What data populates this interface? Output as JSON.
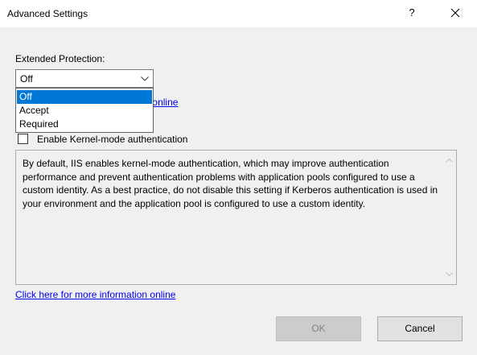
{
  "dialog": {
    "title": "Advanced Settings",
    "help_glyph": "?",
    "close_icon": "close-icon"
  },
  "extended_protection": {
    "label": "Extended Protection:",
    "selected": "Off",
    "options": [
      "Off",
      "Accept",
      "Required"
    ]
  },
  "link_top": {
    "visible_text": "tion online",
    "text": "Click here for more information online"
  },
  "kernel_mode": {
    "label": "Enable Kernel-mode authentication",
    "checked": false
  },
  "description": {
    "text": "By default, IIS enables kernel-mode authentication, which may improve authentication performance and prevent authentication problems with application pools configured to use a custom identity. As a best practice, do not disable this setting if Kerberos authentication is used in your environment and the application pool is configured to use a custom identity."
  },
  "link_bottom": {
    "text": "Click here for more information online"
  },
  "buttons": {
    "ok": "OK",
    "cancel": "Cancel"
  },
  "colors": {
    "selection": "#0078d7",
    "link": "#0000ee",
    "background": "#f0f0f0"
  }
}
